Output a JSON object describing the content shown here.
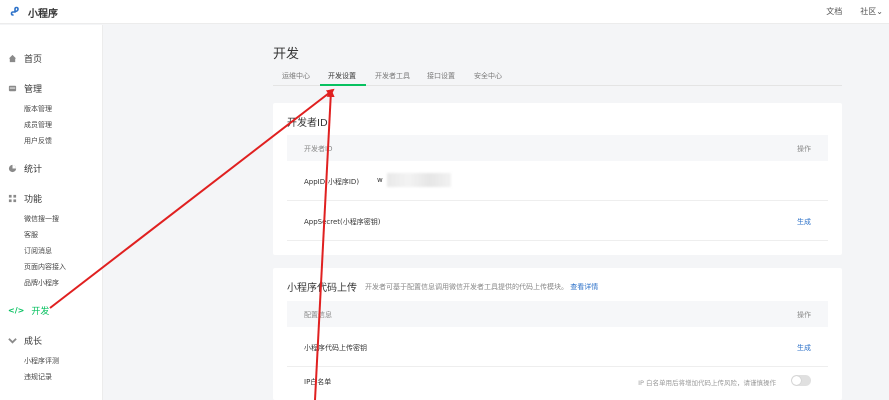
{
  "app": {
    "title": "小程序"
  },
  "topbar": {
    "docs": "文档",
    "community": "社区"
  },
  "sidebar": {
    "home": "首页",
    "manage": {
      "label": "管理",
      "items": [
        "版本管理",
        "成员管理",
        "用户反馈"
      ]
    },
    "stats": "统计",
    "features": {
      "label": "功能",
      "items": [
        "微信搜一搜",
        "客服",
        "订阅消息",
        "页面内容接入",
        "品牌小程序"
      ]
    },
    "dev": "开发",
    "growth": {
      "label": "成长",
      "items": [
        "小程序评测",
        "违规记录"
      ]
    },
    "accent": "#07c160"
  },
  "page": {
    "title": "开发",
    "tabs": [
      "运维中心",
      "开发设置",
      "开发者工具",
      "接口设置",
      "安全中心"
    ],
    "active_tab": "开发设置"
  },
  "developer_id": {
    "title": "开发者ID",
    "header_left": "开发者ID",
    "header_right": "操作",
    "rows": [
      {
        "label": "AppID(小程序ID)",
        "value": "w",
        "action": ""
      },
      {
        "label": "AppSecret(小程序密钥)",
        "value": "",
        "action": "生成"
      }
    ]
  },
  "upload": {
    "title": "小程序代码上传",
    "subtitle": "开发者可基于配置信息调用微信开发者工具提供的代码上传模块。",
    "subtitle_link": "查看详情",
    "header_left": "配置信息",
    "header_right": "操作",
    "rows": [
      {
        "label": "小程序代码上传密钥",
        "action": "生成"
      },
      {
        "label": "IP白名单",
        "hint": "IP 白名单用后将增加代码上传风险，请谨慎操作"
      }
    ]
  },
  "annotation": {
    "arrow_color": "#e02020"
  }
}
